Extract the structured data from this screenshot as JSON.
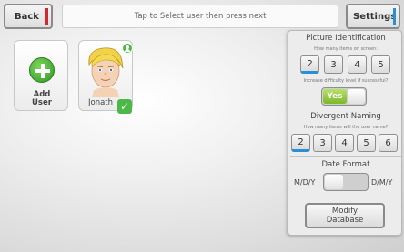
{
  "topbar": {
    "back_label": "Back",
    "prompt": "Tap to Select user then press next",
    "settings_label": "Settings"
  },
  "tiles": {
    "add_user_line1": "Add",
    "add_user_line2": "User",
    "user_name": "Jonath",
    "check_glyph": "✓"
  },
  "settings": {
    "picture_identification": {
      "title": "Picture Identification",
      "items_hint": "How many items on screen:",
      "items_options": [
        "2",
        "3",
        "4",
        "5"
      ],
      "items_selected": "2",
      "difficulty_hint": "Increase difficulty level if successful?",
      "difficulty_value": "Yes"
    },
    "divergent_naming": {
      "title": "Divergent Naming",
      "items_hint": "How many items will the user name?",
      "items_options": [
        "2",
        "3",
        "4",
        "5",
        "6"
      ],
      "items_selected": "2"
    },
    "date_format": {
      "title": "Date Format",
      "left_option": "M/D/Y",
      "right_option": "D/M/Y",
      "selected": "M/D/Y"
    },
    "modify_line1": "Modify",
    "modify_line2": "Database"
  },
  "colors": {
    "back_accent": "#d0282c",
    "settings_accent": "#2b8fd6",
    "yes_green": "#7cb82a",
    "badge_green": "#4db84a"
  }
}
